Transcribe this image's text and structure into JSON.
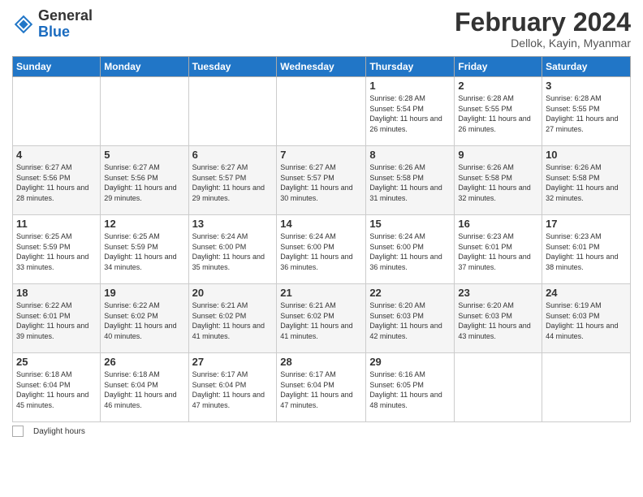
{
  "header": {
    "logo_general": "General",
    "logo_blue": "Blue",
    "month_year": "February 2024",
    "location": "Dellok, Kayin, Myanmar"
  },
  "weekdays": [
    "Sunday",
    "Monday",
    "Tuesday",
    "Wednesday",
    "Thursday",
    "Friday",
    "Saturday"
  ],
  "weeks": [
    [
      {
        "day": "",
        "info": ""
      },
      {
        "day": "",
        "info": ""
      },
      {
        "day": "",
        "info": ""
      },
      {
        "day": "",
        "info": ""
      },
      {
        "day": "1",
        "info": "Sunrise: 6:28 AM\nSunset: 5:54 PM\nDaylight: 11 hours and 26 minutes."
      },
      {
        "day": "2",
        "info": "Sunrise: 6:28 AM\nSunset: 5:55 PM\nDaylight: 11 hours and 26 minutes."
      },
      {
        "day": "3",
        "info": "Sunrise: 6:28 AM\nSunset: 5:55 PM\nDaylight: 11 hours and 27 minutes."
      }
    ],
    [
      {
        "day": "4",
        "info": "Sunrise: 6:27 AM\nSunset: 5:56 PM\nDaylight: 11 hours and 28 minutes."
      },
      {
        "day": "5",
        "info": "Sunrise: 6:27 AM\nSunset: 5:56 PM\nDaylight: 11 hours and 29 minutes."
      },
      {
        "day": "6",
        "info": "Sunrise: 6:27 AM\nSunset: 5:57 PM\nDaylight: 11 hours and 29 minutes."
      },
      {
        "day": "7",
        "info": "Sunrise: 6:27 AM\nSunset: 5:57 PM\nDaylight: 11 hours and 30 minutes."
      },
      {
        "day": "8",
        "info": "Sunrise: 6:26 AM\nSunset: 5:58 PM\nDaylight: 11 hours and 31 minutes."
      },
      {
        "day": "9",
        "info": "Sunrise: 6:26 AM\nSunset: 5:58 PM\nDaylight: 11 hours and 32 minutes."
      },
      {
        "day": "10",
        "info": "Sunrise: 6:26 AM\nSunset: 5:58 PM\nDaylight: 11 hours and 32 minutes."
      }
    ],
    [
      {
        "day": "11",
        "info": "Sunrise: 6:25 AM\nSunset: 5:59 PM\nDaylight: 11 hours and 33 minutes."
      },
      {
        "day": "12",
        "info": "Sunrise: 6:25 AM\nSunset: 5:59 PM\nDaylight: 11 hours and 34 minutes."
      },
      {
        "day": "13",
        "info": "Sunrise: 6:24 AM\nSunset: 6:00 PM\nDaylight: 11 hours and 35 minutes."
      },
      {
        "day": "14",
        "info": "Sunrise: 6:24 AM\nSunset: 6:00 PM\nDaylight: 11 hours and 36 minutes."
      },
      {
        "day": "15",
        "info": "Sunrise: 6:24 AM\nSunset: 6:00 PM\nDaylight: 11 hours and 36 minutes."
      },
      {
        "day": "16",
        "info": "Sunrise: 6:23 AM\nSunset: 6:01 PM\nDaylight: 11 hours and 37 minutes."
      },
      {
        "day": "17",
        "info": "Sunrise: 6:23 AM\nSunset: 6:01 PM\nDaylight: 11 hours and 38 minutes."
      }
    ],
    [
      {
        "day": "18",
        "info": "Sunrise: 6:22 AM\nSunset: 6:01 PM\nDaylight: 11 hours and 39 minutes."
      },
      {
        "day": "19",
        "info": "Sunrise: 6:22 AM\nSunset: 6:02 PM\nDaylight: 11 hours and 40 minutes."
      },
      {
        "day": "20",
        "info": "Sunrise: 6:21 AM\nSunset: 6:02 PM\nDaylight: 11 hours and 41 minutes."
      },
      {
        "day": "21",
        "info": "Sunrise: 6:21 AM\nSunset: 6:02 PM\nDaylight: 11 hours and 41 minutes."
      },
      {
        "day": "22",
        "info": "Sunrise: 6:20 AM\nSunset: 6:03 PM\nDaylight: 11 hours and 42 minutes."
      },
      {
        "day": "23",
        "info": "Sunrise: 6:20 AM\nSunset: 6:03 PM\nDaylight: 11 hours and 43 minutes."
      },
      {
        "day": "24",
        "info": "Sunrise: 6:19 AM\nSunset: 6:03 PM\nDaylight: 11 hours and 44 minutes."
      }
    ],
    [
      {
        "day": "25",
        "info": "Sunrise: 6:18 AM\nSunset: 6:04 PM\nDaylight: 11 hours and 45 minutes."
      },
      {
        "day": "26",
        "info": "Sunrise: 6:18 AM\nSunset: 6:04 PM\nDaylight: 11 hours and 46 minutes."
      },
      {
        "day": "27",
        "info": "Sunrise: 6:17 AM\nSunset: 6:04 PM\nDaylight: 11 hours and 47 minutes."
      },
      {
        "day": "28",
        "info": "Sunrise: 6:17 AM\nSunset: 6:04 PM\nDaylight: 11 hours and 47 minutes."
      },
      {
        "day": "29",
        "info": "Sunrise: 6:16 AM\nSunset: 6:05 PM\nDaylight: 11 hours and 48 minutes."
      },
      {
        "day": "",
        "info": ""
      },
      {
        "day": "",
        "info": ""
      }
    ]
  ],
  "footer": {
    "daylight_label": "Daylight hours"
  }
}
